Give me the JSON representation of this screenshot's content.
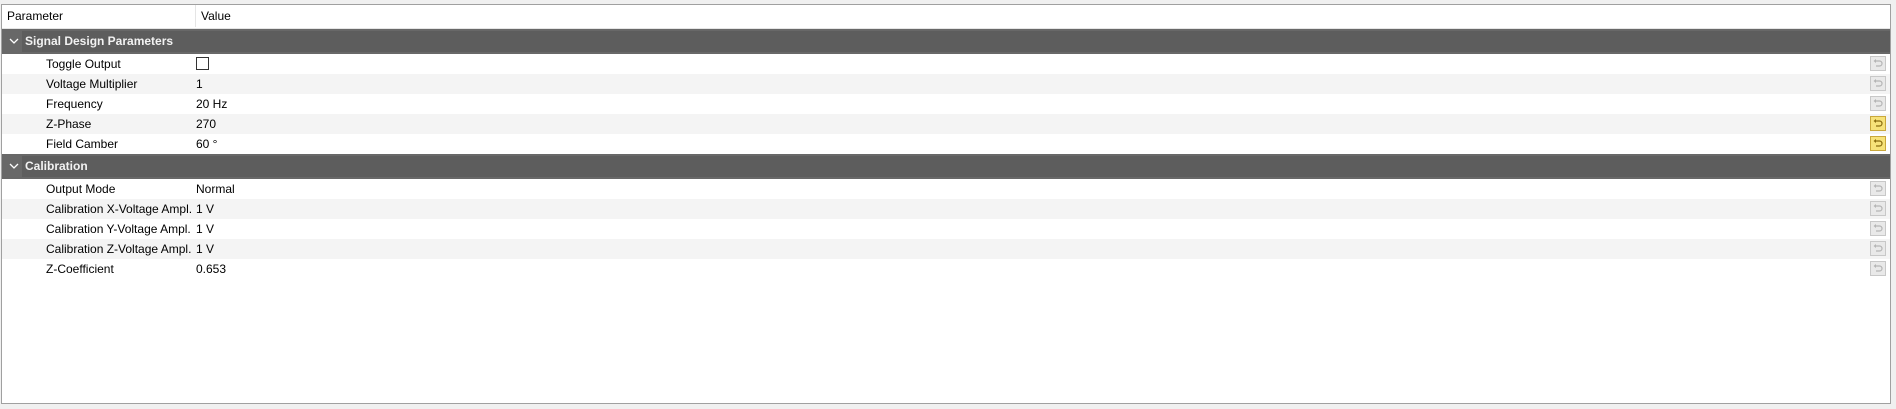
{
  "header": {
    "param_label": "Parameter",
    "value_label": "Value"
  },
  "groups": [
    {
      "title": "Signal Design Parameters",
      "rows": [
        {
          "name": "Toggle Output",
          "value": "",
          "checkbox": true,
          "checked": false,
          "modified": false
        },
        {
          "name": "Voltage Multiplier",
          "value": "1",
          "modified": false
        },
        {
          "name": "Frequency",
          "value": "20 Hz",
          "modified": false
        },
        {
          "name": "Z-Phase",
          "value": "270",
          "modified": true
        },
        {
          "name": "Field Camber",
          "value": "60 °",
          "modified": true
        }
      ]
    },
    {
      "title": "Calibration",
      "rows": [
        {
          "name": "Output Mode",
          "value": "Normal",
          "modified": false
        },
        {
          "name": "Calibration X-Voltage Ampl.",
          "value": "1 V",
          "modified": false
        },
        {
          "name": "Calibration Y-Voltage Ampl.",
          "value": "1 V",
          "modified": false
        },
        {
          "name": "Calibration Z-Voltage Ampl.",
          "value": "1 V",
          "modified": false
        },
        {
          "name": "Z-Coefficient",
          "value": "0.653",
          "modified": false
        }
      ]
    }
  ],
  "colors": {
    "group_header_bg": "#686868",
    "reset_active": "#f6e27a",
    "reset_inactive": "#e9e9e9"
  },
  "icons": {
    "collapse": "chevron-down-icon",
    "reset": "undo-icon"
  }
}
